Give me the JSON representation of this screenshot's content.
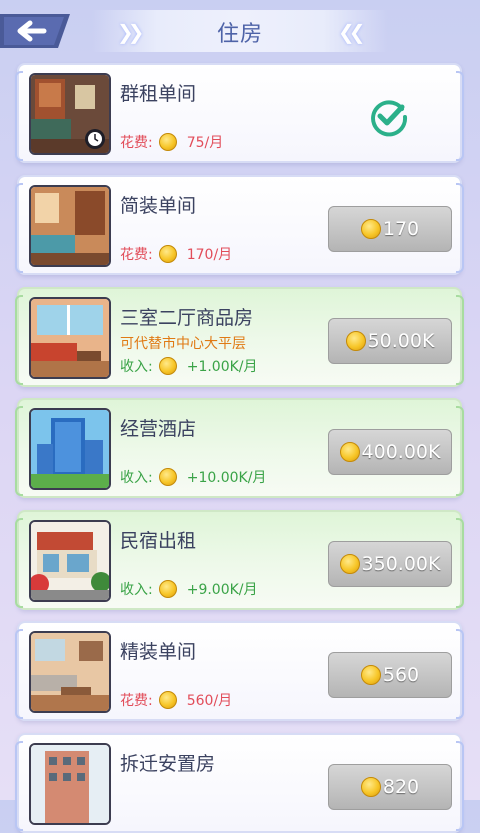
{
  "header": {
    "title": "住房"
  },
  "cards": [
    {
      "name": "群租单间",
      "subtitle": "",
      "cost_label": "花费:",
      "cost_value": "75/月",
      "type": "cost",
      "owned": true,
      "price": ""
    },
    {
      "name": "简装单间",
      "subtitle": "",
      "cost_label": "花费:",
      "cost_value": "170/月",
      "type": "cost",
      "owned": false,
      "price": "170"
    },
    {
      "name": "三室二厅商品房",
      "subtitle": "可代替市中心大平层",
      "cost_label": "收入:",
      "cost_value": "+1.00K/月",
      "type": "income",
      "owned": false,
      "price": "50.00K"
    },
    {
      "name": "经营酒店",
      "subtitle": "",
      "cost_label": "收入:",
      "cost_value": "+10.00K/月",
      "type": "income",
      "owned": false,
      "price": "400.00K"
    },
    {
      "name": "民宿出租",
      "subtitle": "",
      "cost_label": "收入:",
      "cost_value": "+9.00K/月",
      "type": "income",
      "owned": false,
      "price": "350.00K"
    },
    {
      "name": "精装单间",
      "subtitle": "",
      "cost_label": "花费:",
      "cost_value": "560/月",
      "type": "cost",
      "owned": false,
      "price": "560"
    },
    {
      "name": "拆迁安置房",
      "subtitle": "",
      "cost_label": "",
      "cost_value": "",
      "type": "cost",
      "owned": false,
      "price": "820"
    }
  ],
  "colors": {
    "cost": "#e24d5a",
    "income": "#3aa347",
    "check": "#2bb08a"
  }
}
